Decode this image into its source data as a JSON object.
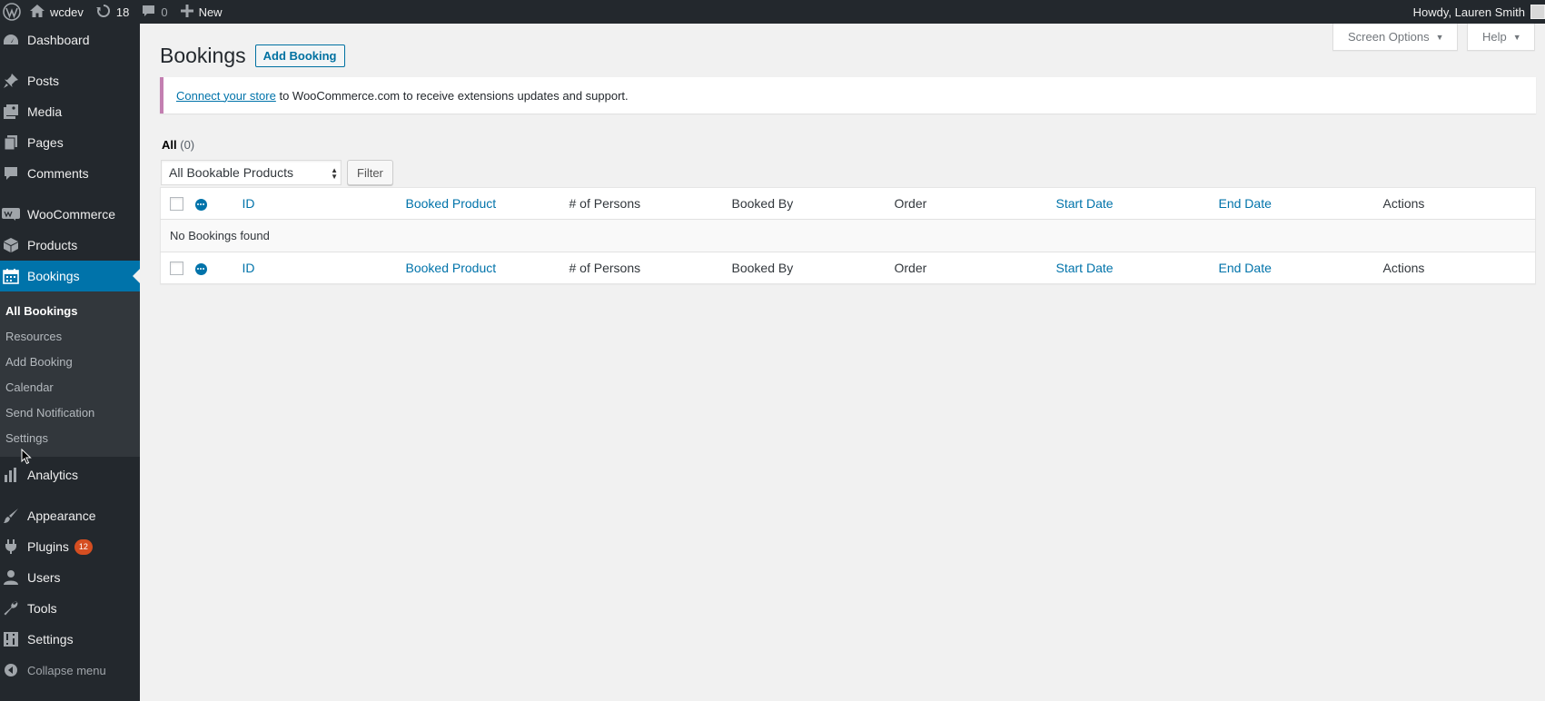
{
  "adminbar": {
    "site_name": "wcdev",
    "updates_count": "18",
    "comments_count": "0",
    "new_label": "New",
    "greeting": "Howdy, Lauren Smith"
  },
  "sidebar": {
    "dashboard": "Dashboard",
    "posts": "Posts",
    "media": "Media",
    "pages": "Pages",
    "comments": "Comments",
    "woocommerce": "WooCommerce",
    "products": "Products",
    "bookings": "Bookings",
    "submenu": {
      "all_bookings": "All Bookings",
      "resources": "Resources",
      "add_booking": "Add Booking",
      "calendar": "Calendar",
      "send_notification": "Send Notification",
      "settings": "Settings"
    },
    "analytics": "Analytics",
    "appearance": "Appearance",
    "plugins": "Plugins",
    "plugins_badge": "12",
    "users": "Users",
    "tools": "Tools",
    "settings": "Settings",
    "collapse": "Collapse menu"
  },
  "screen_meta": {
    "screen_options": "Screen Options",
    "help": "Help"
  },
  "page": {
    "title": "Bookings",
    "add_button": "Add Booking"
  },
  "notice": {
    "link": "Connect your store",
    "text": " to WooCommerce.com to receive extensions updates and support."
  },
  "views": {
    "all_label": "All",
    "all_count": "(0)"
  },
  "filters": {
    "selected": "All Bookable Products",
    "button": "Filter"
  },
  "table": {
    "columns": {
      "id": "ID",
      "booked_product": "Booked Product",
      "persons": "# of Persons",
      "booked_by": "Booked By",
      "order": "Order",
      "start_date": "Start Date",
      "end_date": "End Date",
      "actions": "Actions"
    },
    "empty_message": "No Bookings found"
  },
  "colors": {
    "admin_dark": "#23282d",
    "accent": "#0073aa",
    "notice_border": "#c37fb1",
    "badge": "#d54e21"
  }
}
